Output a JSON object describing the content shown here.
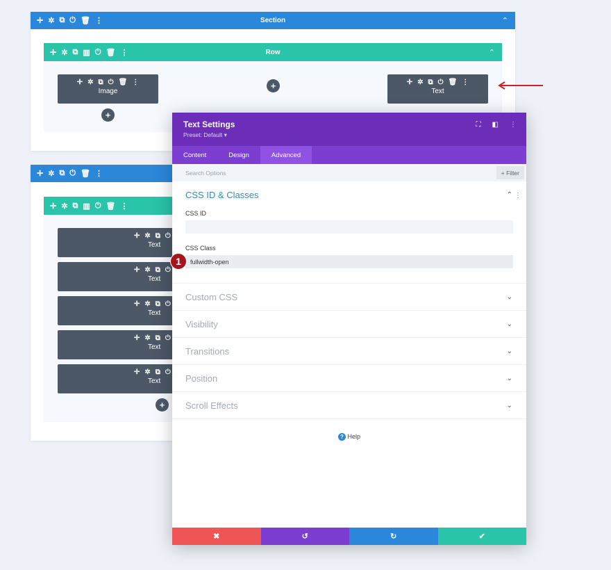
{
  "section1": {
    "title": "Section",
    "row_title": "Row",
    "modules": [
      "Image",
      "Text"
    ]
  },
  "section2": {
    "modules": [
      "Text",
      "Text",
      "Text",
      "Text",
      "Text"
    ]
  },
  "icons": {
    "move": "✛",
    "gear": "✲",
    "duplicate": "⧉",
    "columns": "▥",
    "power": "⏻",
    "trash": "🗑",
    "more": "⋮",
    "chevron_up": "⌃",
    "plus": "+"
  },
  "modal": {
    "title": "Text Settings",
    "preset": "Preset: Default ▾",
    "tabs": [
      "Content",
      "Design",
      "Advanced"
    ],
    "active_tab": "Advanced",
    "search_placeholder": "Search Options",
    "filter_label": "+ Filter",
    "group_title": "CSS ID & Classes",
    "css_id_label": "CSS ID",
    "css_id_value": "",
    "css_class_label": "CSS Class",
    "css_class_value": "fullwidth-open",
    "step_badge": "1",
    "toggles": [
      "Custom CSS",
      "Visibility",
      "Transitions",
      "Position",
      "Scroll Effects"
    ],
    "help_label": "Help"
  },
  "footer": {
    "cancel": "✖",
    "undo": "↺",
    "redo": "↻",
    "save": "✔"
  },
  "colors": {
    "section": "#2b87da",
    "row": "#29c4a9",
    "module": "#4c5866",
    "modal_header": "#6c2eb9",
    "tabs": "#7b3ed0",
    "cancel": "#ef5555",
    "undo": "#7b3ed0",
    "redo": "#2b87da",
    "save": "#29c4a9",
    "arrow": "#d0202a"
  }
}
